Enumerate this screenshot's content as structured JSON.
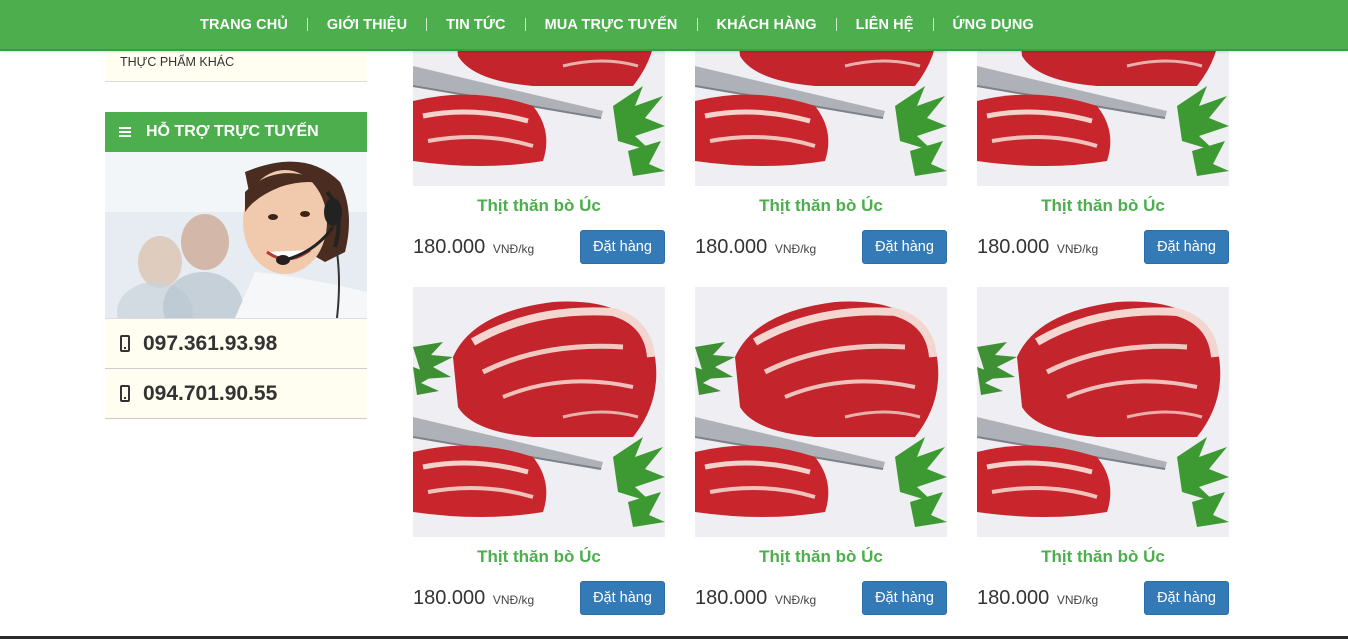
{
  "nav": {
    "items": [
      "TRANG CHỦ",
      "GIỚI THIỆU",
      "TIN TỨC",
      "MUA TRỰC TUYẾN",
      "KHÁCH HÀNG",
      "LIÊN HỆ",
      "ỨNG DỤNG"
    ]
  },
  "sidebar": {
    "category_item": "THỰC PHẨM KHÁC",
    "support_title": "HỖ TRỢ TRỰC TUYẾN",
    "phones": [
      "097.361.93.98",
      "094.701.90.55"
    ]
  },
  "products": [
    {
      "name": "Thịt thăn bò Úc",
      "price": "180.000",
      "unit": "VNĐ/kg",
      "button": "Đặt hàng"
    },
    {
      "name": "Thịt thăn bò Úc",
      "price": "180.000",
      "unit": "VNĐ/kg",
      "button": "Đặt hàng"
    },
    {
      "name": "Thịt thăn bò Úc",
      "price": "180.000",
      "unit": "VNĐ/kg",
      "button": "Đặt hàng"
    },
    {
      "name": "Thịt thăn bò Úc",
      "price": "180.000",
      "unit": "VNĐ/kg",
      "button": "Đặt hàng"
    },
    {
      "name": "Thịt thăn bò Úc",
      "price": "180.000",
      "unit": "VNĐ/kg",
      "button": "Đặt hàng"
    },
    {
      "name": "Thịt thăn bò Úc",
      "price": "180.000",
      "unit": "VNĐ/kg",
      "button": "Đặt hàng"
    }
  ],
  "colors": {
    "brand_green": "#4cae4c",
    "button_blue": "#337ab7",
    "panel_cream": "#fffef0"
  }
}
